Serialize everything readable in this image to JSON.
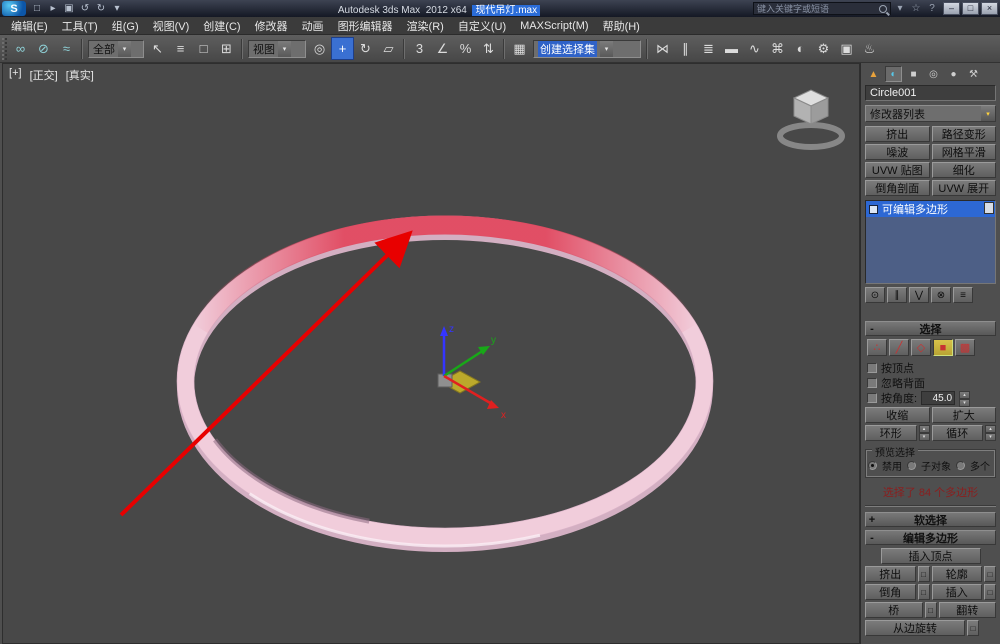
{
  "titlebar": {
    "product": "Autodesk 3ds Max",
    "version": "2012 x64",
    "filename": "现代吊灯.max",
    "search_placeholder": "键入关键字或短语"
  },
  "menus": [
    "编辑(E)",
    "工具(T)",
    "组(G)",
    "视图(V)",
    "创建(C)",
    "修改器",
    "动画",
    "图形编辑器",
    "渲染(R)",
    "自定义(U)",
    "MAXScript(M)",
    "帮助(H)"
  ],
  "toolbar": {
    "selection_filter": "全部",
    "coord_system": "视图",
    "snap_digit": "3",
    "named_selection_sets": "创建选择集"
  },
  "viewport": {
    "menu_plus": "+",
    "menu_pov": "正交",
    "menu_shading": "真实",
    "axis_x": "x",
    "axis_y": "y",
    "axis_z": "z"
  },
  "panel": {
    "object_name": "Circle001",
    "modifier_list_label": "修改器列表",
    "modifier_buttons": [
      "挤出",
      "路径变形",
      "噪波",
      "网格平滑",
      "UVW 贴图",
      "细化",
      "倒角剖面",
      "UVW 展开"
    ],
    "stack_item": "可编辑多边形",
    "selection": {
      "title": "选择",
      "by_vertex": "按顶点",
      "ignore_backfacing": "忽略背面",
      "by_angle": "按角度:",
      "angle_value": "45.0",
      "shrink": "收缩",
      "grow": "扩大",
      "ring": "环形",
      "loop": "循环",
      "preview_title": "预览选择",
      "opt_disabled": "禁用",
      "opt_subobject": "子对象",
      "opt_multiple": "多个",
      "status": "选择了 84 个多边形"
    },
    "soft_selection_title": "软选择",
    "edit_poly": {
      "title": "编辑多边形",
      "insert_vertex": "插入顶点",
      "extrude": "挤出",
      "outline": "轮廓",
      "bevel": "倒角",
      "inset": "插入",
      "bridge": "桥",
      "flip": "翻转",
      "rotate_from_edge": "从边旋转"
    }
  },
  "icons": {
    "logo_letter": "S",
    "new": "□",
    "open": "▸",
    "save": "▣",
    "undo": "↺",
    "redo": "↻",
    "caret_down": "▾",
    "star": "☆",
    "help_q": "?",
    "win_min": "–",
    "win_max": "□",
    "win_close": "×",
    "link": "∞",
    "unlink": "⊘",
    "bind_warp": "≈",
    "select": "↖",
    "select_by_name": "≡",
    "region_rect": "□",
    "window_crossing": "⊞",
    "pivot_center": "◎",
    "move": "+",
    "rotate": "↻",
    "scale": "▱",
    "snap_angle": "∠",
    "snap_percent": "%",
    "snap_spinner": "⇅",
    "edit_sets": "▦",
    "mirror": "⋈",
    "align": "∥",
    "layers": "≣",
    "ribbon": "▬",
    "curve_editor": "∿",
    "schematic": "⌘",
    "material": "◐",
    "render_setup": "⚙",
    "render_frame": "▣",
    "render": "♨",
    "tab_create": "▲",
    "tab_modify": "◐",
    "tab_hierarchy": "■",
    "tab_motion": "◎",
    "tab_display": "●",
    "tab_utilities": "⚒",
    "so_vertex": "∴",
    "so_edge": "╱",
    "so_border": "◇",
    "so_polygon": "■",
    "so_element": "▩",
    "pin": "⊙",
    "show_end": "∥",
    "unique": "⋁",
    "remove": "⊗",
    "config": "≡",
    "up": "▴",
    "down": "▾",
    "minus": "-",
    "plus": "+",
    "settings_box": "□"
  },
  "colors": {
    "accent_blue": "#2a6cd8",
    "ring_pink": "#f1cddb",
    "ring_red": "#e0485f",
    "arrow_red": "#e80000"
  }
}
